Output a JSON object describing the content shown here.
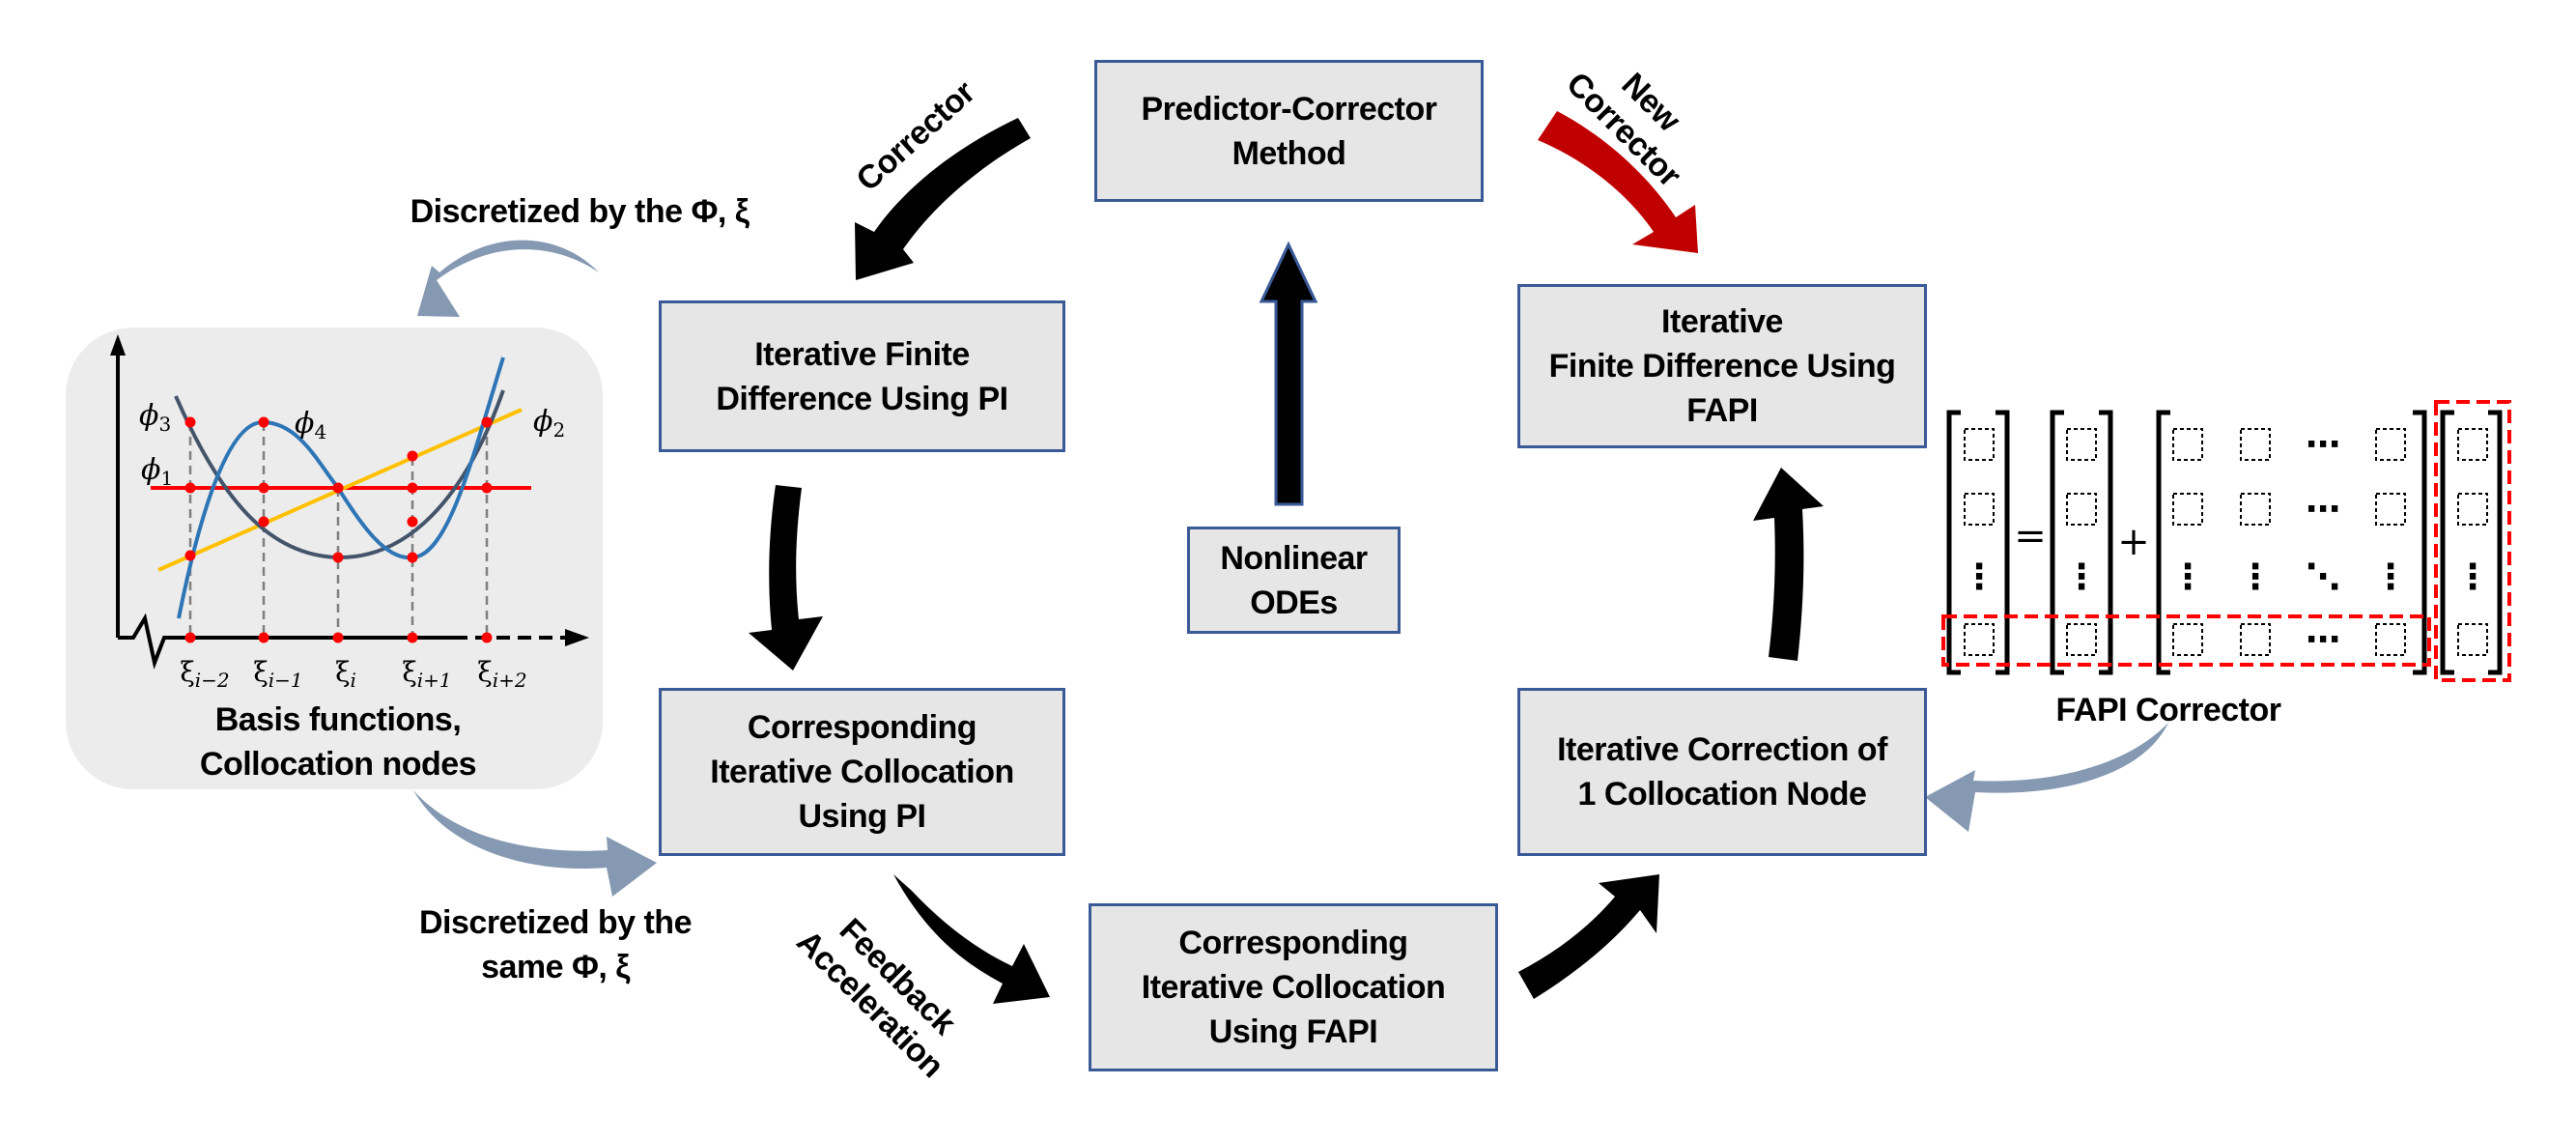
{
  "diagram": {
    "title": "FAPI predictor-corrector iterative collocation workflow",
    "colors": {
      "box_fill": "#e6e6e6",
      "box_border": "#3a5a97",
      "flow_arrow": "#000000",
      "new_corrector_arrow": "#c00000",
      "discretize_arrow": "#8599b3",
      "highlight_dashed": "#ff0000",
      "panel_fill": "#ececec",
      "phi1_line": "#ff0000",
      "phi2_line": "#ffc000",
      "phi3_curve": "#44546a",
      "phi4_curve": "#2e75b6",
      "node_marker": "#ff0000"
    },
    "boxes": {
      "predictor_corrector": [
        "Predictor-Corrector",
        "Method"
      ],
      "fd_pi": [
        "Iterative Finite",
        "Difference Using PI"
      ],
      "nonlinear_odes": [
        "Nonlinear",
        "ODEs"
      ],
      "fd_fapi": [
        "Iterative",
        "Finite Difference Using",
        "FAPI"
      ],
      "colloc_pi": [
        "Corresponding",
        "Iterative Collocation",
        "Using PI"
      ],
      "colloc_fapi": [
        "Corresponding",
        "Iterative Collocation",
        "Using FAPI"
      ],
      "correction_node": [
        "Iterative Correction of",
        "1 Collocation Node"
      ]
    },
    "arrow_labels": {
      "corrector": "Corrector",
      "new_corrector": [
        "New",
        "Corrector"
      ],
      "feedback": [
        "Feedback",
        "Acceleration"
      ],
      "discretized_top": "Discretized by the Φ, ξ",
      "discretized_bottom": [
        "Discretized by the",
        "same Φ, ξ"
      ]
    },
    "basis_panel": {
      "caption": [
        "Basis functions,",
        "Collocation nodes"
      ],
      "functions": [
        "ϕ1",
        "ϕ2",
        "ϕ3",
        "ϕ4"
      ],
      "function_labels": {
        "phi1": "ϕ",
        "phi1_sub": "1",
        "phi2": "ϕ",
        "phi2_sub": "2",
        "phi3": "ϕ",
        "phi3_sub": "3",
        "phi4": "ϕ",
        "phi4_sub": "4"
      },
      "nodes": [
        {
          "base": "ξ",
          "sub": "i−2"
        },
        {
          "base": "ξ",
          "sub": "i−1"
        },
        {
          "base": "ξ",
          "sub": "i"
        },
        {
          "base": "ξ",
          "sub": "i+1"
        },
        {
          "base": "ξ",
          "sub": "i+2"
        }
      ]
    },
    "fapi_corrector": {
      "caption": "FAPI Corrector",
      "equals": "=",
      "plus": "+",
      "hdots": "⋯",
      "vdots": "⋮",
      "ddots": "⋱"
    }
  }
}
